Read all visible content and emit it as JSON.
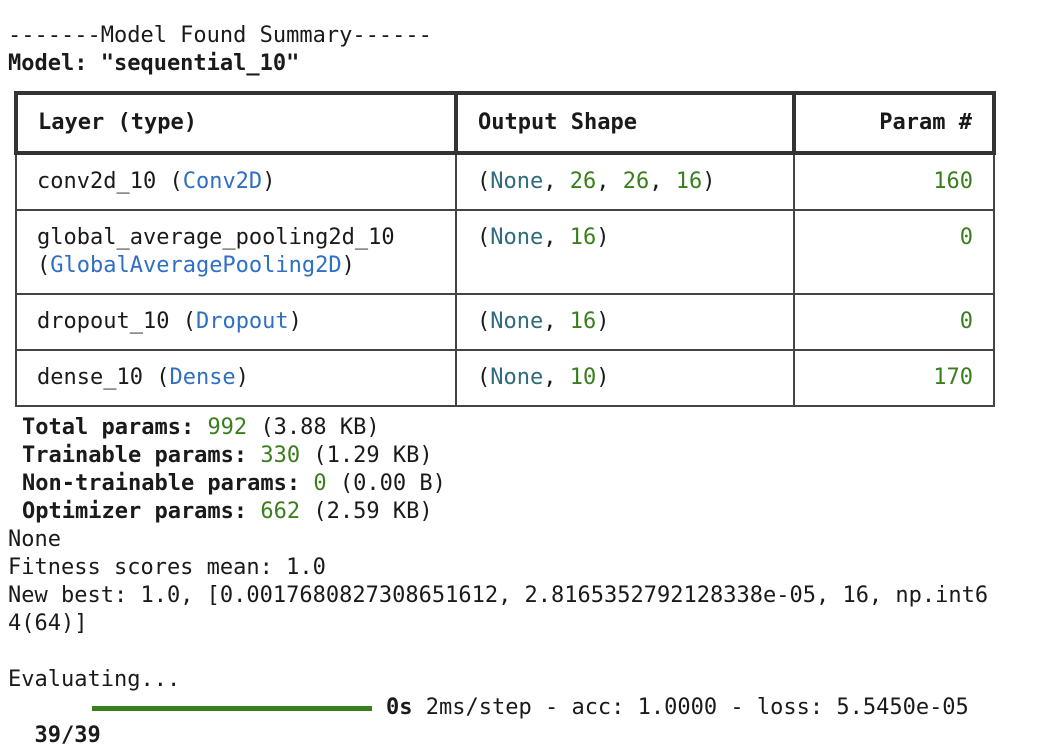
{
  "header": {
    "found_line": "-------Model Found Summary------",
    "model_label": "Model: \"sequential_10\""
  },
  "table": {
    "headers": [
      "Layer (type)",
      "Output Shape",
      "Param #"
    ],
    "rows": [
      {
        "layer_name": "conv2d_10 (",
        "layer_class": "Conv2D",
        "layer_close": ")",
        "shape_open": "(",
        "shape_none": "None",
        "shape_rest": ", ",
        "shape_vals": [
          "26",
          "26",
          "16"
        ],
        "params": "160"
      },
      {
        "layer_name": "global_average_pooling2d_10",
        "layer_line2_open": "(",
        "layer_class": "GlobalAveragePooling2D",
        "layer_close": ")",
        "shape_open": "(",
        "shape_none": "None",
        "shape_vals": [
          "16"
        ],
        "params": "0"
      },
      {
        "layer_name": "dropout_10 (",
        "layer_class": "Dropout",
        "layer_close": ")",
        "shape_open": "(",
        "shape_none": "None",
        "shape_vals": [
          "16"
        ],
        "params": "0"
      },
      {
        "layer_name": "dense_10 (",
        "layer_class": "Dense",
        "layer_close": ")",
        "shape_open": "(",
        "shape_none": "None",
        "shape_vals": [
          "10"
        ],
        "params": "170"
      }
    ]
  },
  "params": {
    "total_label": "Total params:",
    "total_value": "992",
    "total_size": "(3.88 KB)",
    "trainable_label": "Trainable params:",
    "trainable_value": "330",
    "trainable_size": "(1.29 KB)",
    "nontrainable_label": "Non-trainable params:",
    "nontrainable_value": "0",
    "nontrainable_size": "(0.00 B)",
    "optimizer_label": "Optimizer params:",
    "optimizer_value": "662",
    "optimizer_size": "(2.59 KB)"
  },
  "output": {
    "none_line": "None",
    "fitness_line": "Fitness scores mean: 1.0",
    "best_line1": "New best: 1.0, [0.0017680827308651612, 2.8165352792128338e-05, 16, np.int6",
    "best_line2": "4(64)]",
    "evaluating_line": "Evaluating..."
  },
  "progress": {
    "steps": "39/39",
    "fraction": 1.0,
    "time": "0s",
    "metrics": "2ms/step - acc: 1.0000 - loss: 5.5450e-05"
  },
  "colors": {
    "number": "#3a7f1e",
    "class_name": "#2f6fc4",
    "none_keyword": "#2e6b7d",
    "bar_fill": "#3a7f1e"
  }
}
